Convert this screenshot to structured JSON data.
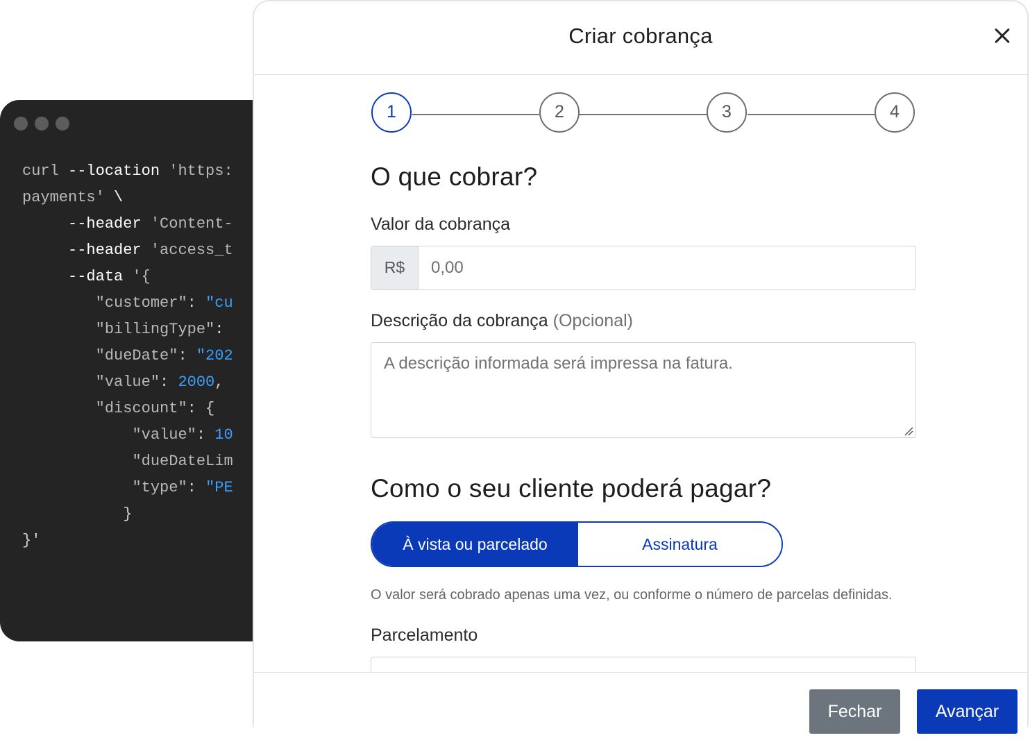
{
  "code_window": {
    "dots": [
      "window-dot",
      "window-dot",
      "window-dot"
    ],
    "lines": [
      {
        "indent": "",
        "tokens": [
          {
            "t": "curl",
            "c": "str"
          },
          {
            "t": " --location ",
            "c": "kw"
          },
          {
            "t": "'https:",
            "c": "str"
          }
        ]
      },
      {
        "indent": "",
        "tokens": [
          {
            "t": "payments'",
            "c": "str"
          },
          {
            "t": " \\",
            "c": "kw"
          }
        ]
      },
      {
        "indent": "     ",
        "tokens": [
          {
            "t": "--header",
            "c": "kw"
          },
          {
            "t": " 'Content-",
            "c": "str"
          }
        ]
      },
      {
        "indent": "     ",
        "tokens": [
          {
            "t": "--header",
            "c": "kw"
          },
          {
            "t": " 'access_t",
            "c": "str"
          }
        ]
      },
      {
        "indent": "     ",
        "tokens": [
          {
            "t": "--data",
            "c": "kw"
          },
          {
            "t": " '{",
            "c": "str"
          }
        ]
      },
      {
        "indent": "        ",
        "tokens": [
          {
            "t": "\"customer\"",
            "c": "str"
          },
          {
            "t": ": ",
            "c": "punct"
          },
          {
            "t": "\"cu",
            "c": "blue"
          }
        ]
      },
      {
        "indent": "        ",
        "tokens": [
          {
            "t": "\"billingType\"",
            "c": "str"
          },
          {
            "t": ":",
            "c": "punct"
          }
        ]
      },
      {
        "indent": "        ",
        "tokens": [
          {
            "t": "\"dueDate\"",
            "c": "str"
          },
          {
            "t": ": ",
            "c": "punct"
          },
          {
            "t": "\"202",
            "c": "blue"
          }
        ]
      },
      {
        "indent": "        ",
        "tokens": [
          {
            "t": "\"value\"",
            "c": "str"
          },
          {
            "t": ": ",
            "c": "punct"
          },
          {
            "t": "2000",
            "c": "blue"
          },
          {
            "t": ",",
            "c": "punct"
          }
        ]
      },
      {
        "indent": "        ",
        "tokens": [
          {
            "t": "\"discount\"",
            "c": "str"
          },
          {
            "t": ": {",
            "c": "punct"
          }
        ]
      },
      {
        "indent": "            ",
        "tokens": [
          {
            "t": "\"value\"",
            "c": "str"
          },
          {
            "t": ": ",
            "c": "punct"
          },
          {
            "t": "10",
            "c": "blue"
          }
        ]
      },
      {
        "indent": "            ",
        "tokens": [
          {
            "t": "\"dueDateLim",
            "c": "str"
          }
        ]
      },
      {
        "indent": "            ",
        "tokens": [
          {
            "t": "\"type\"",
            "c": "str"
          },
          {
            "t": ": ",
            "c": "punct"
          },
          {
            "t": "\"PE",
            "c": "blue"
          }
        ]
      },
      {
        "indent": "           ",
        "tokens": [
          {
            "t": "}",
            "c": "punct"
          }
        ]
      },
      {
        "indent": "",
        "tokens": [
          {
            "t": "}'",
            "c": "punct"
          }
        ]
      }
    ]
  },
  "modal": {
    "title": "Criar cobrança",
    "close_icon": "close-icon",
    "steps": [
      "1",
      "2",
      "3",
      "4"
    ],
    "active_step": "1",
    "section_what": "O que cobrar?",
    "amount_label": "Valor da cobrança",
    "currency_prefix": "R$",
    "amount_placeholder": "0,00",
    "description_label": "Descrição da cobrança",
    "description_optional": "(Opcional)",
    "description_placeholder": "A descrição informada será impressa na fatura.",
    "section_how": "Como o seu cliente poderá pagar?",
    "payment_modes": [
      {
        "label": "À vista ou parcelado",
        "selected": true
      },
      {
        "label": "Assinatura",
        "selected": false
      }
    ],
    "payment_help": "O valor será cobrado apenas uma vez, ou conforme o número de parcelas definidas.",
    "installments_label": "Parcelamento",
    "close_button": "Fechar",
    "next_button": "Avançar"
  },
  "colors": {
    "primary": "#0b3ab8",
    "secondary": "#6c757d",
    "code_bg": "#242424",
    "code_blue": "#3aa0ff"
  }
}
